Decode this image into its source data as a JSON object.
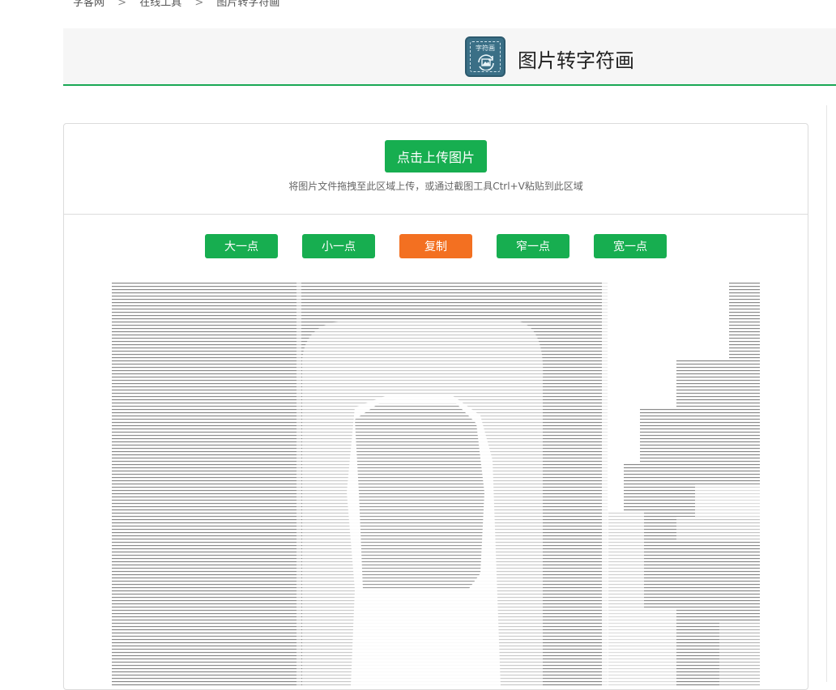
{
  "breadcrumb": {
    "home": "字客网",
    "sep": ">",
    "tools": "在线工具",
    "current": "图片转字符画"
  },
  "header": {
    "logo_text": "字符画",
    "title": "图片转字符画"
  },
  "upload": {
    "button_label": "点击上传图片",
    "hint": "将图片文件拖拽至此区域上传，或通过截图工具Ctrl+V粘贴到此区域"
  },
  "controls": {
    "bigger": "大一点",
    "smaller": "小一点",
    "copy": "复制",
    "narrower": "窄一点",
    "wider": "宽一点"
  },
  "colors": {
    "accent_green": "#17ae50",
    "accent_orange": "#f37021",
    "logo_bg": "#3a6f86"
  },
  "icons": [
    "image-icon",
    "refresh-arrows-icon"
  ]
}
